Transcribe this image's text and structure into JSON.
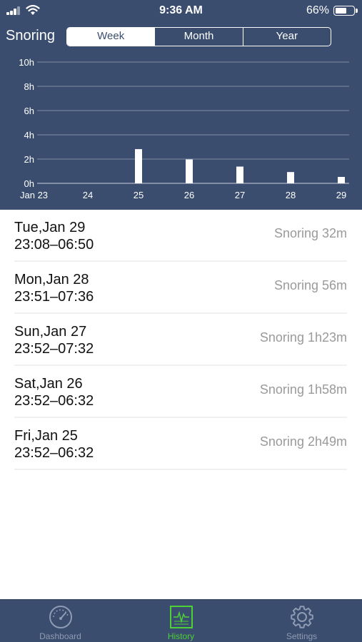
{
  "status_bar": {
    "time": "9:36 AM",
    "battery": "66%",
    "battery_level": 0.66
  },
  "header": {
    "title": "Snoring"
  },
  "period_tabs": [
    {
      "label": "Week",
      "active": true
    },
    {
      "label": "Month",
      "active": false
    },
    {
      "label": "Year",
      "active": false
    }
  ],
  "chart_data": {
    "type": "bar",
    "title": "",
    "xlabel": "",
    "ylabel": "",
    "categories": [
      "Jan 23",
      "24",
      "25",
      "26",
      "27",
      "28",
      "29"
    ],
    "values": [
      0,
      0,
      2.82,
      1.97,
      1.38,
      0.93,
      0.53
    ],
    "ylim": [
      0,
      10
    ],
    "yticks": [
      "0h",
      "2h",
      "4h",
      "6h",
      "8h",
      "10h"
    ],
    "ytick_values": [
      0,
      2,
      4,
      6,
      8,
      10
    ],
    "grid": true,
    "bar_color": "#ffffff",
    "background": "#3a4d6e"
  },
  "records": [
    {
      "day": "Tue,Jan 29",
      "range": "23:08–06:50",
      "snoring": "Snoring 32m"
    },
    {
      "day": "Mon,Jan 28",
      "range": "23:51–07:36",
      "snoring": "Snoring 56m"
    },
    {
      "day": "Sun,Jan 27",
      "range": "23:52–07:32",
      "snoring": "Snoring 1h23m"
    },
    {
      "day": "Sat,Jan 26",
      "range": "23:52–06:32",
      "snoring": "Snoring 1h58m"
    },
    {
      "day": "Fri,Jan 25",
      "range": "23:52–06:32",
      "snoring": "Snoring 2h49m"
    }
  ],
  "tab_bar": [
    {
      "label": "Dashboard",
      "icon": "speedometer-icon",
      "active": false
    },
    {
      "label": "History",
      "icon": "history-chart-icon",
      "active": true
    },
    {
      "label": "Settings",
      "icon": "gear-icon",
      "active": false
    }
  ],
  "colors": {
    "header_bg": "#3a4d6e",
    "active_tab": "#4cd137",
    "inactive_tab": "#8e9bb2"
  }
}
